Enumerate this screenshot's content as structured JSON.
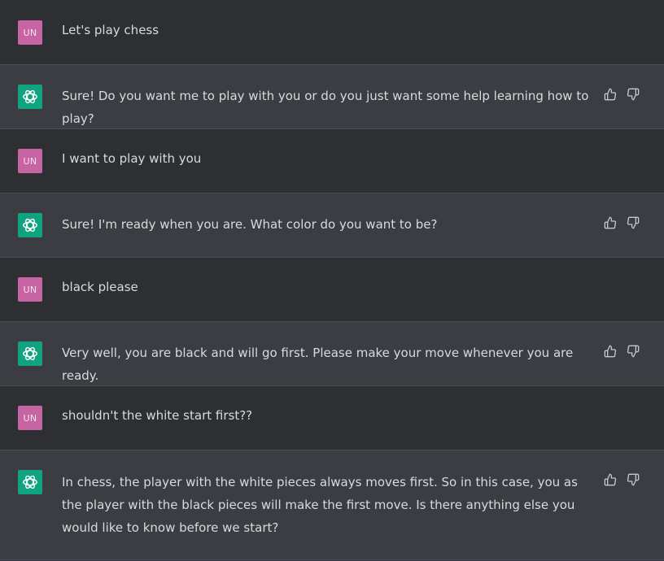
{
  "user_avatar_initials": "UN",
  "messages": [
    {
      "role": "user",
      "text": "Let's play chess"
    },
    {
      "role": "assistant",
      "text": "Sure! Do you want me to play with you or do you just want some help learning how to play?"
    },
    {
      "role": "user",
      "text": "I want to play with you"
    },
    {
      "role": "assistant",
      "text": "Sure! I'm ready when you are. What color do you want to be?"
    },
    {
      "role": "user",
      "text": "black please"
    },
    {
      "role": "assistant",
      "text": "Very well, you are black and will go first. Please make your move whenever you are ready."
    },
    {
      "role": "user",
      "text": "shouldn't the white start first??"
    },
    {
      "role": "assistant",
      "text": "In chess, the player with the white pieces always moves first. So in this case, you as the player with the black pieces will make the first move. Is there anything else you would like to know before we start?"
    }
  ],
  "icons": {
    "assistant_avatar": "openai-logo-icon",
    "like": "thumbs-up-icon",
    "dislike": "thumbs-down-icon"
  },
  "colors": {
    "user_row_bg": "#2d2f33",
    "assistant_row_bg": "#3b3d42",
    "user_avatar_bg": "#c764a4",
    "assistant_avatar_bg": "#10a37f"
  }
}
